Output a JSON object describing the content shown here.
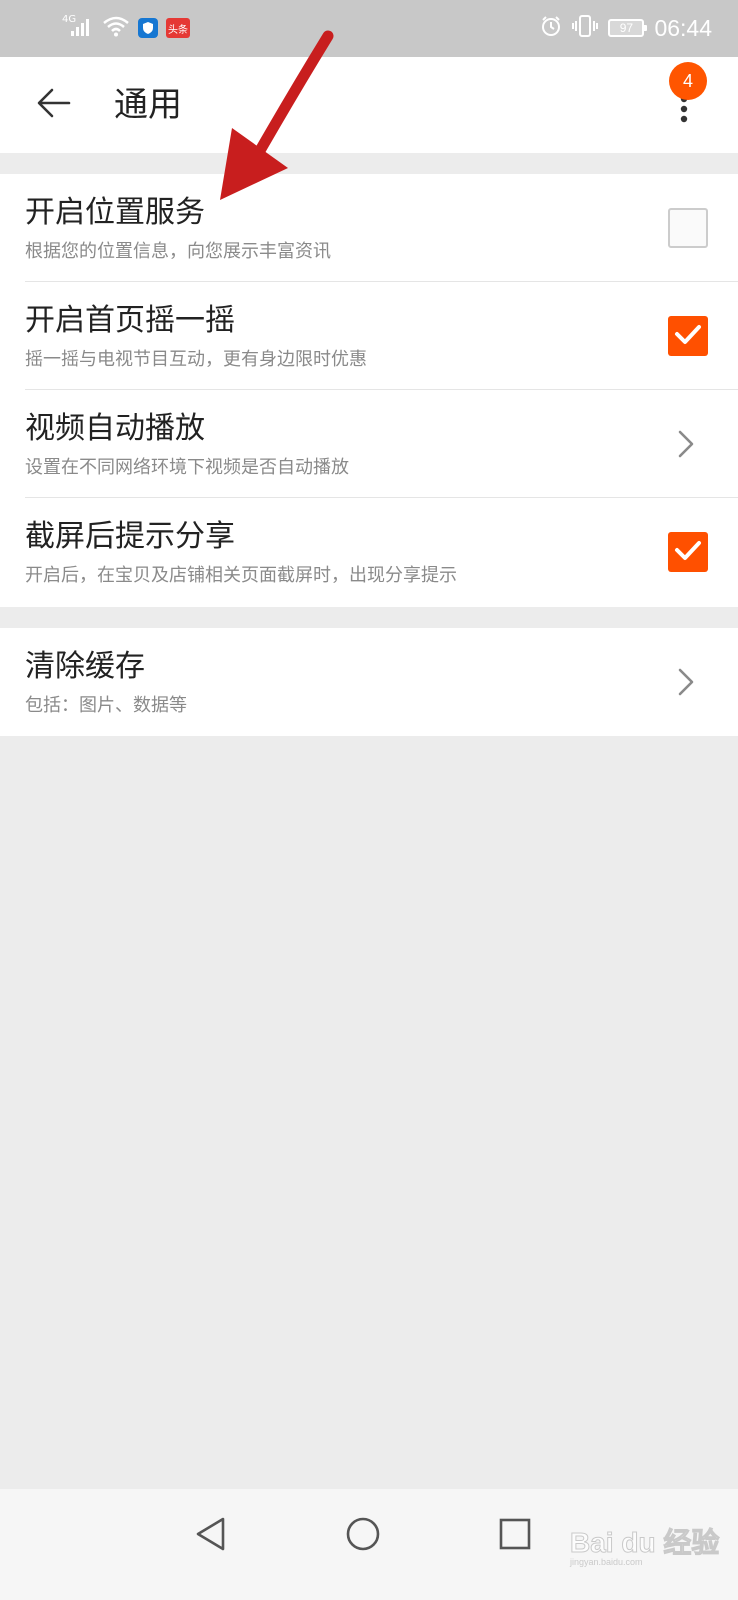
{
  "status_bar": {
    "network_label": "4G",
    "app_icon_label": "头条",
    "battery_level": "97",
    "time": "06:44"
  },
  "header": {
    "title": "通用",
    "notification_count": "4"
  },
  "settings": [
    {
      "title": "开启位置服务",
      "subtitle": "根据您的位置信息，向您展示丰富资讯",
      "control": "checkbox",
      "checked": false
    },
    {
      "title": "开启首页摇一摇",
      "subtitle": "摇一摇与电视节目互动，更有身边限时优惠",
      "control": "checkbox",
      "checked": true
    },
    {
      "title": "视频自动播放",
      "subtitle": "设置在不同网络环境下视频是否自动播放",
      "control": "chevron"
    },
    {
      "title": "截屏后提示分享",
      "subtitle": "开启后，在宝贝及店铺相关页面截屏时，出现分享提示",
      "control": "checkbox",
      "checked": true
    }
  ],
  "settings_secondary": [
    {
      "title": "清除缓存",
      "subtitle": "包括：图片、数据等",
      "control": "chevron"
    }
  ],
  "watermark": {
    "brand": "Bai du 经验",
    "url": "jingyan.baidu.com"
  },
  "colors": {
    "accent": "#ff5000",
    "annotation_arrow": "#c81e1e",
    "status_bar_bg": "#c8c8c8",
    "page_bg": "#ececec"
  },
  "icons": {
    "back": "arrow-left-icon",
    "more": "more-vertical-icon",
    "chevron": "chevron-right-icon",
    "check": "checkmark-icon"
  }
}
